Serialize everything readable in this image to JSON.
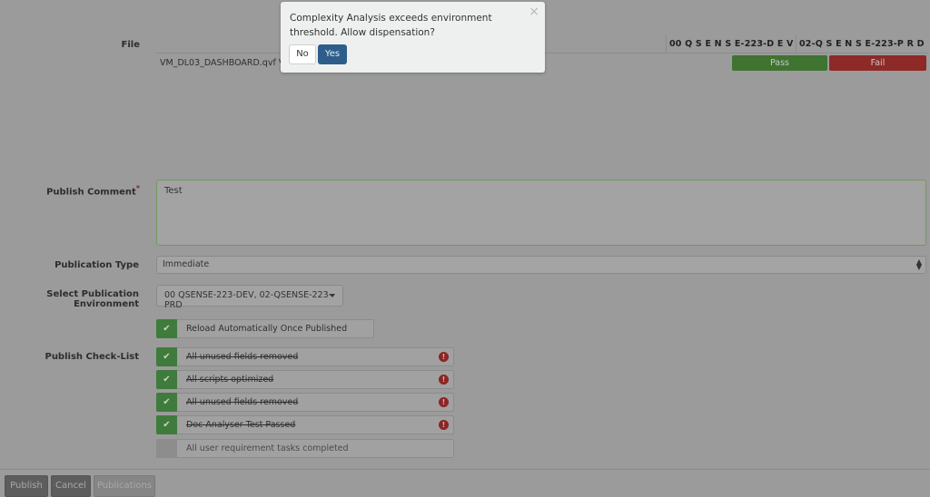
{
  "modal": {
    "message": "Complexity Analysis exceeds environment threshold. Allow dispensation?",
    "close_icon": "×",
    "no_label": "No",
    "yes_label": "Yes"
  },
  "file_section": {
    "label": "File",
    "file_name": "VM_DL03_DASHBOARD.qvf V1.0",
    "environments": [
      {
        "name": "00 Q S E N S E-223-D E V",
        "status": "Pass",
        "status_color": "#3f7330"
      },
      {
        "name": "02-Q S E N S E-223-P R D",
        "status": "Fail",
        "status_color": "#8d2a27"
      }
    ]
  },
  "publish_comment": {
    "label": "Publish Comment",
    "required_marker": "*",
    "value": "Test"
  },
  "publication_type": {
    "label": "Publication Type",
    "selected": "Immediate",
    "arrows_icon": "⬍"
  },
  "environment_select": {
    "label": "Select Publication Environment",
    "selected": "00 QSENSE-223-DEV,  02-QSENSE-223-PRD"
  },
  "reload_option": {
    "label": "Reload Automatically Once Published",
    "checked": true,
    "check_icon": "✔"
  },
  "checklist": {
    "label": "Publish Check-List",
    "items": [
      {
        "label": "All unused fields removed",
        "checked": true,
        "warning": true
      },
      {
        "label": "All scripts optimized",
        "checked": true,
        "warning": true
      },
      {
        "label": "All unused fields removed",
        "checked": true,
        "warning": true
      },
      {
        "label": "Doc Analyser Test Passed",
        "checked": true,
        "warning": true
      },
      {
        "label": "All user requirement tasks completed",
        "checked": false,
        "warning": false
      }
    ],
    "check_icon": "✔",
    "warning_icon": "!"
  },
  "footer": {
    "publish_label": "Publish",
    "cancel_label": "Cancel",
    "publications_label": "Publications"
  }
}
